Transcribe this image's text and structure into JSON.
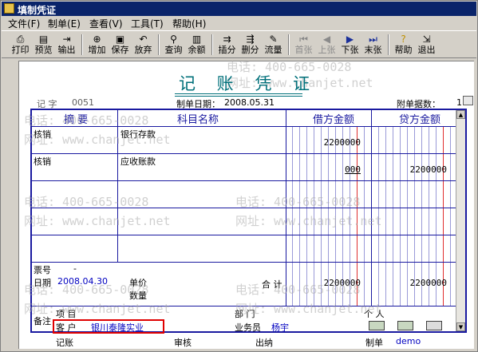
{
  "window": {
    "title": "填制凭证"
  },
  "menu": [
    "文件(F)",
    "制单(E)",
    "查看(V)",
    "工具(T)",
    "帮助(H)"
  ],
  "toolbar": {
    "print": "打印",
    "preview": "预览",
    "export": "输出",
    "add": "增加",
    "save": "保存",
    "discard": "放弃",
    "query": "查询",
    "balance": "余额",
    "insert": "插分",
    "delete": "删分",
    "flow": "流量",
    "first": "首张",
    "prev": "上张",
    "next": "下张",
    "last": "末张",
    "help": "帮助",
    "exit": "退出"
  },
  "voucher": {
    "title": "记 账 凭 证",
    "type_label": "记 字",
    "number": "0051",
    "date_label": "制单日期：",
    "date": "2008.05.31",
    "attach_label": "附单据数：",
    "attach_value": "1"
  },
  "columns": {
    "summary": "摘 要",
    "account": "科目名称",
    "debit": "借方金额",
    "credit": "贷方金额"
  },
  "rows": [
    {
      "summary": "核销",
      "account": "银行存款",
      "debit": "2200000",
      "credit": ""
    },
    {
      "summary": "核销",
      "account": "应收账款",
      "debit": "000",
      "credit": "2200000"
    }
  ],
  "bottom": {
    "ticket_label": "票号",
    "ticket_value": "-",
    "date_label": "日期",
    "date_value": "2008.04.30",
    "price_label": "单价",
    "qty_label": "数量",
    "total_label": "合 计",
    "total_debit": "2200000",
    "total_credit": "2200000",
    "note_label": "备注",
    "project_label": "项  目",
    "customer_label": "客  户",
    "customer_value": "银川泰隆实业",
    "dept_label": "部  门",
    "person_label": "个  人",
    "salesman_label": "业务员",
    "salesman_value": "杨宇"
  },
  "footer": {
    "bookkeep": "记账",
    "audit": "审核",
    "cashier": "出纳",
    "maker": "制单",
    "maker_value": "demo"
  },
  "watermarks": [
    "电话: 400-665-0028",
    "网址: www.chanjet.net"
  ],
  "colors": {
    "accent": "#00707a",
    "grid": "#1a1aa0",
    "highlight": "#e00000",
    "titlebar": "#0a246a"
  }
}
